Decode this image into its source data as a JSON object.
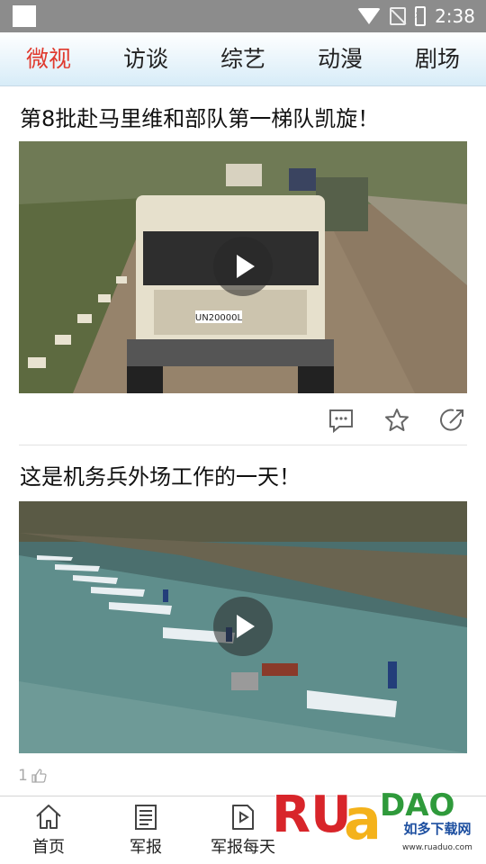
{
  "status_bar": {
    "time": "2:38"
  },
  "tabs": [
    {
      "label": "微视",
      "active": true
    },
    {
      "label": "访谈",
      "active": false
    },
    {
      "label": "综艺",
      "active": false
    },
    {
      "label": "动漫",
      "active": false
    },
    {
      "label": "剧场",
      "active": false
    }
  ],
  "feed": [
    {
      "title": "第8批赴马里维和部队第一梯队凯旋！",
      "plate": "UN20000L"
    },
    {
      "title": "这是机务兵外场工作的一天！",
      "likes": "1"
    }
  ],
  "bottom_nav": [
    {
      "label": "首页",
      "icon": "home-icon"
    },
    {
      "label": "军报",
      "icon": "newspaper-icon"
    },
    {
      "label": "军报每天",
      "icon": "video-icon"
    }
  ],
  "watermark": {
    "brand": "RUANDAO",
    "text": "如多下载网",
    "url": "www.ruaduo.com"
  },
  "colors": {
    "accent": "#e03a2e",
    "tab_bg": "#d7ecf8",
    "status_bar": "#8c8c8c"
  }
}
